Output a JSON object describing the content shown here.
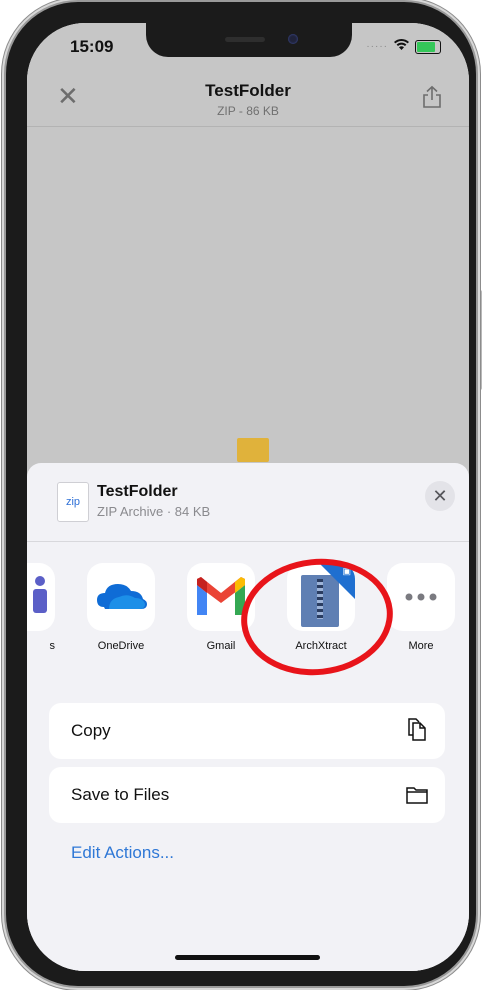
{
  "status": {
    "time": "15:09"
  },
  "nav": {
    "title": "TestFolder",
    "subtitle": "ZIP - 86 KB"
  },
  "sheet": {
    "file_thumb_label": "zip",
    "file_name": "TestFolder",
    "file_meta": "ZIP Archive · 84 KB",
    "apps": [
      {
        "label": "s",
        "icon": "teams-icon"
      },
      {
        "label": "OneDrive",
        "icon": "onedrive-icon"
      },
      {
        "label": "Gmail",
        "icon": "gmail-icon"
      },
      {
        "label": "ArchXtract",
        "icon": "archxtract-icon"
      },
      {
        "label": "More",
        "icon": "more-icon"
      }
    ],
    "actions": [
      {
        "label": "Copy",
        "icon": "copy-icon"
      },
      {
        "label": "Save to Files",
        "icon": "folder-icon"
      }
    ],
    "edit_actions": "Edit Actions..."
  },
  "colors": {
    "accent": "#2f78d6",
    "highlight": "#e8141a"
  }
}
